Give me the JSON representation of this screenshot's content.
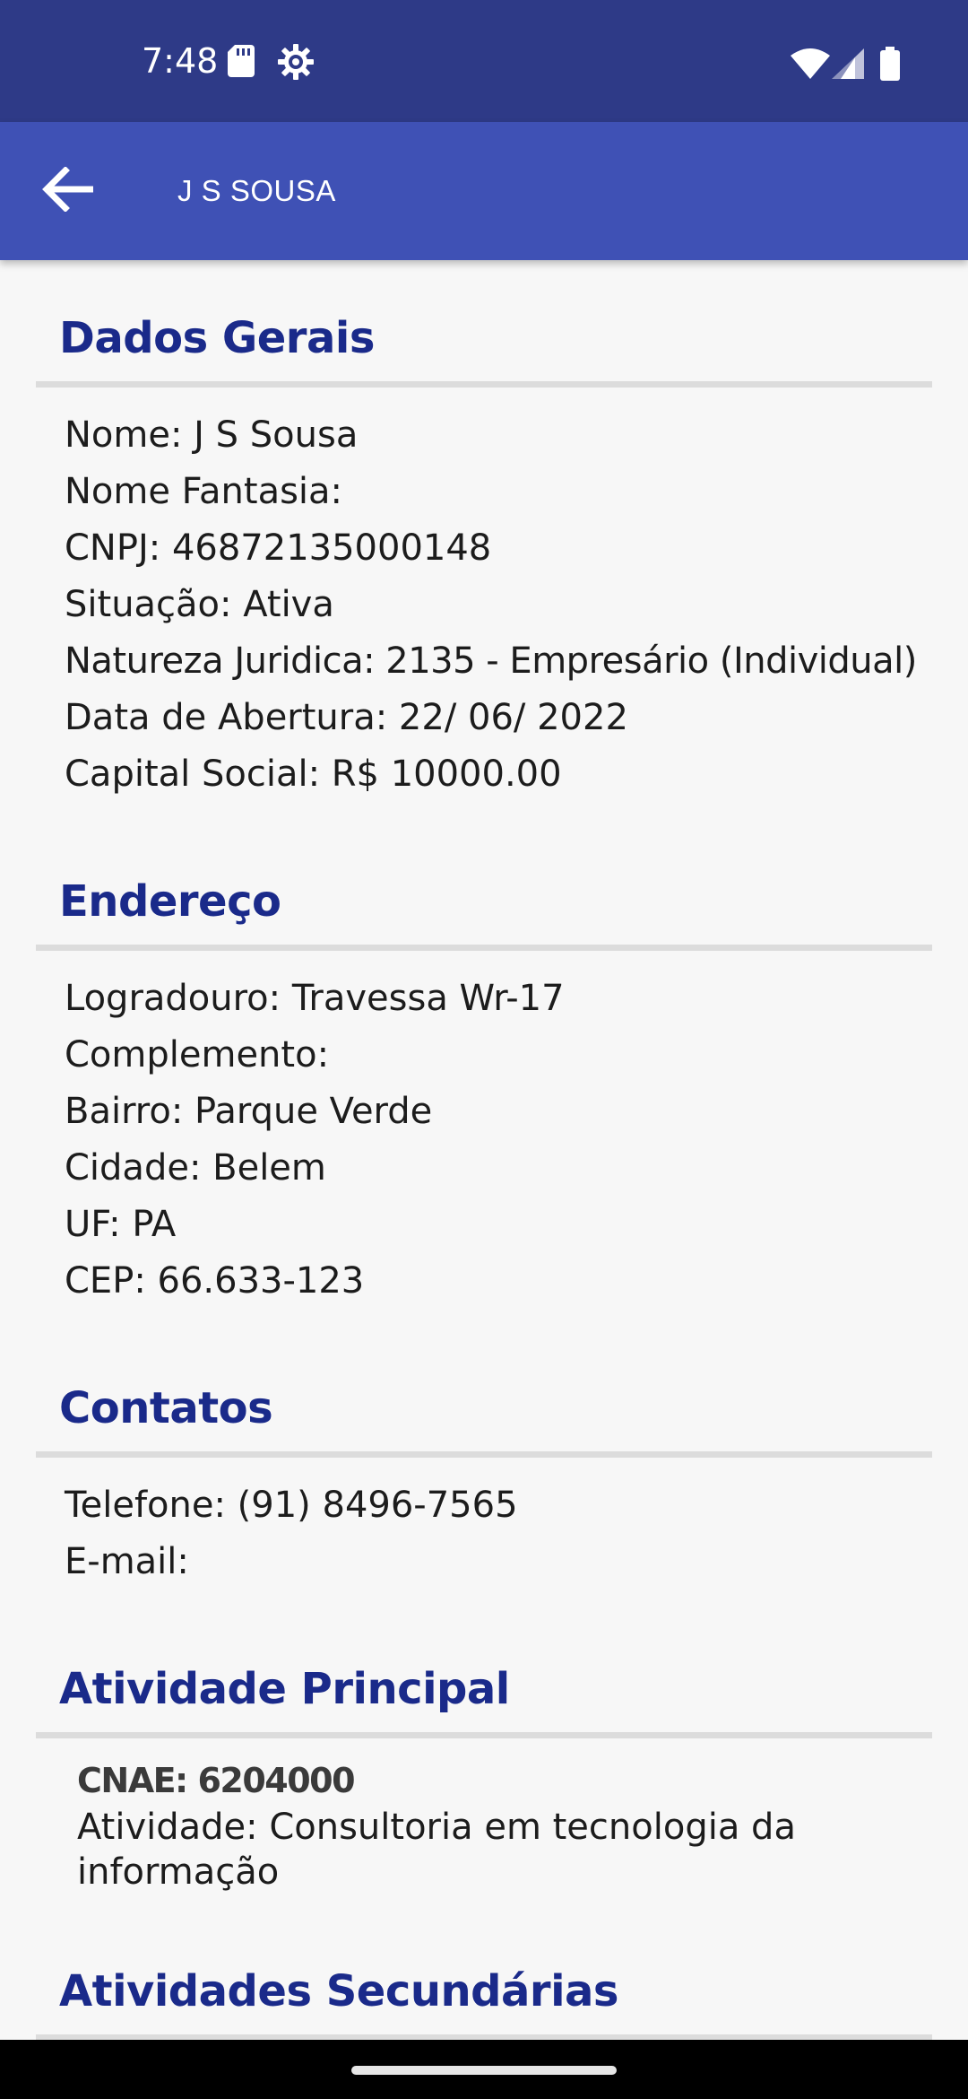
{
  "status_bar": {
    "time": "7:48",
    "left_icons": [
      "sd-card-icon",
      "settings-gear-icon"
    ],
    "right_icons": [
      "wifi-icon",
      "cell-signal-icon",
      "battery-icon"
    ]
  },
  "app_bar": {
    "back_icon": "arrow-back-icon",
    "title": "J S SOUSA"
  },
  "dados_gerais": {
    "title": "Dados Gerais",
    "fields": [
      "Nome: J S Sousa",
      "Nome Fantasia:",
      "CNPJ: 46872135000148",
      "Situação: Ativa",
      "Natureza Juridica: 2135 - Empresário (Individual)",
      "Data de Abertura: 22/ 06/ 2022",
      "Capital Social: R$ 10000.00"
    ]
  },
  "endereco": {
    "title": "Endereço",
    "fields": [
      "Logradouro: Travessa Wr-17",
      "Complemento:",
      "Bairro: Parque Verde",
      "Cidade: Belem",
      "UF: PA",
      "CEP: 66.633-123"
    ]
  },
  "contatos": {
    "title": "Contatos",
    "fields": [
      "Telefone: (91) 8496-7565",
      "E-mail:"
    ]
  },
  "atividade_principal": {
    "title": "Atividade Principal",
    "cnae": "CNAE: 6204000",
    "atividade": "Atividade: Consultoria em tecnologia da informação"
  },
  "atividades_secundarias": {
    "title": "Atividades Secundárias"
  },
  "colors": {
    "status_bar": "#2e3a87",
    "app_bar": "#3f51b5",
    "section_title": "#1a2a8a",
    "background": "#f7f7f7"
  }
}
